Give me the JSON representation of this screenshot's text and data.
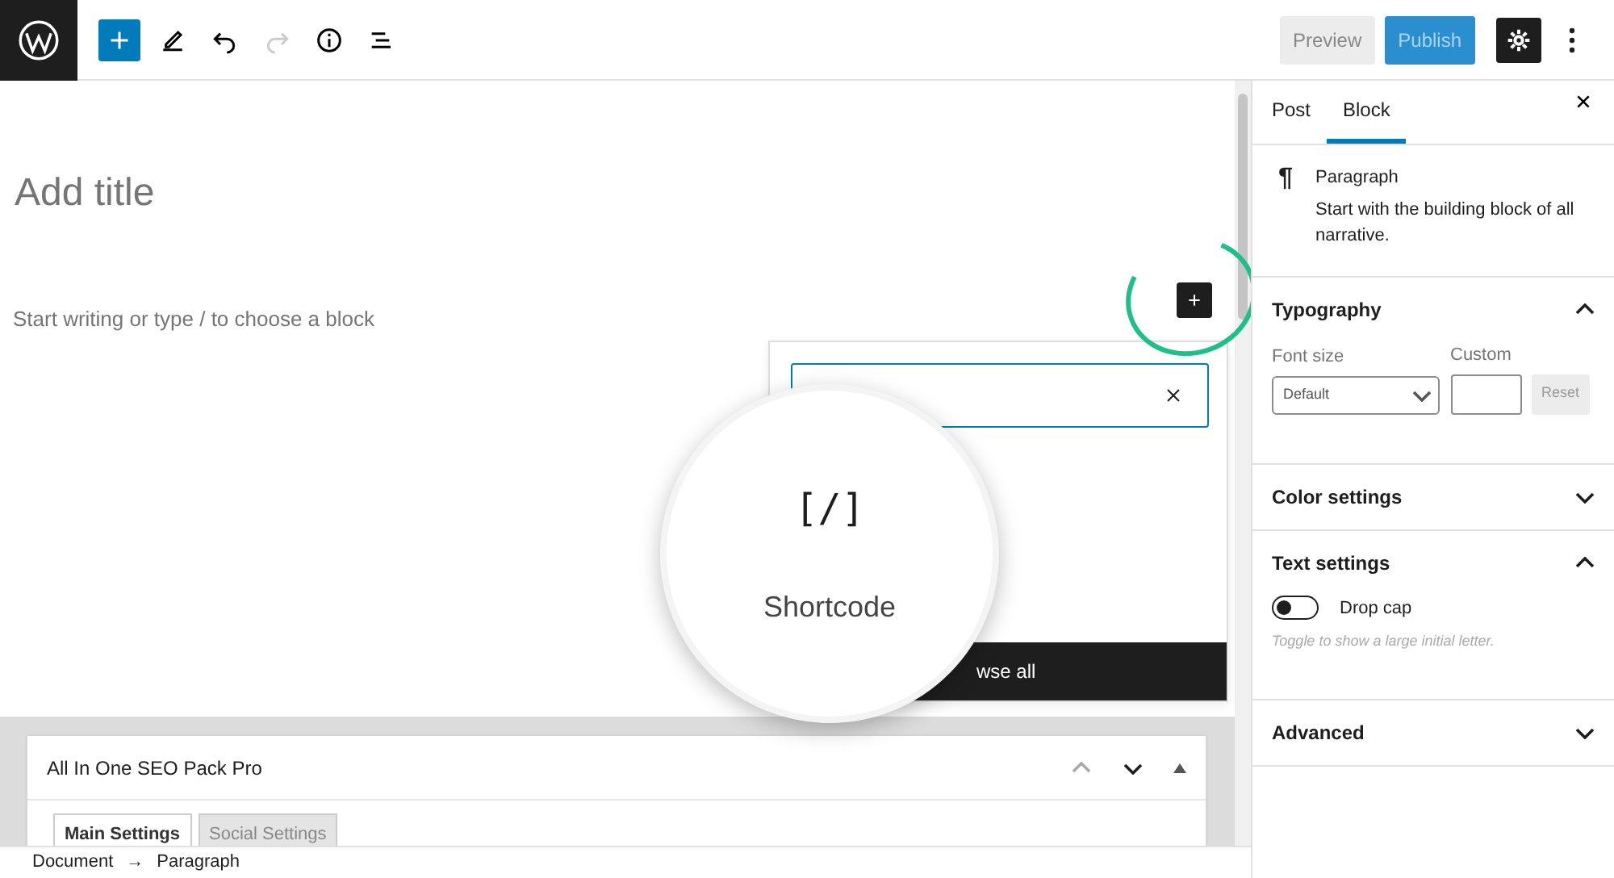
{
  "toolbar": {
    "buttons": [
      {
        "label": "Preview",
        "kind": "secondary"
      },
      {
        "label": "Publish",
        "kind": "primary"
      }
    ]
  },
  "editor": {
    "title_placeholder": "Add title",
    "block_placeholder": "Start writing or type / to choose a block"
  },
  "inserter": {
    "browse_all": "wse all"
  },
  "magnifier": {
    "icon": "[/]",
    "label": "Shortcode"
  },
  "sidebar": {
    "tabs": [
      {
        "label": "Post",
        "selected": false
      },
      {
        "label": "Block",
        "selected": true
      }
    ],
    "block_card": {
      "icon": "¶",
      "title": "Paragraph",
      "description": "Start with the building block of all narrative."
    },
    "panels": [
      {
        "title": "Typography",
        "expanded": true,
        "kind": "typography",
        "font_size_label": "Font size",
        "font_size_value": "Default",
        "custom_label": "Custom",
        "reset": "Reset"
      },
      {
        "title": "Color settings",
        "expanded": false
      },
      {
        "title": "Text settings",
        "expanded": true,
        "kind": "text",
        "toggle_label": "Drop cap",
        "toggle_on": false,
        "help": "Toggle to show a large initial letter."
      },
      {
        "title": "Advanced",
        "expanded": false
      }
    ]
  },
  "metabox": {
    "title": "All In One SEO Pack Pro",
    "tabs": [
      {
        "label": "Main Settings",
        "selected": true
      },
      {
        "label": "Social Settings",
        "selected": false
      }
    ]
  },
  "breadcrumb": [
    "Document",
    "→",
    "Paragraph"
  ]
}
